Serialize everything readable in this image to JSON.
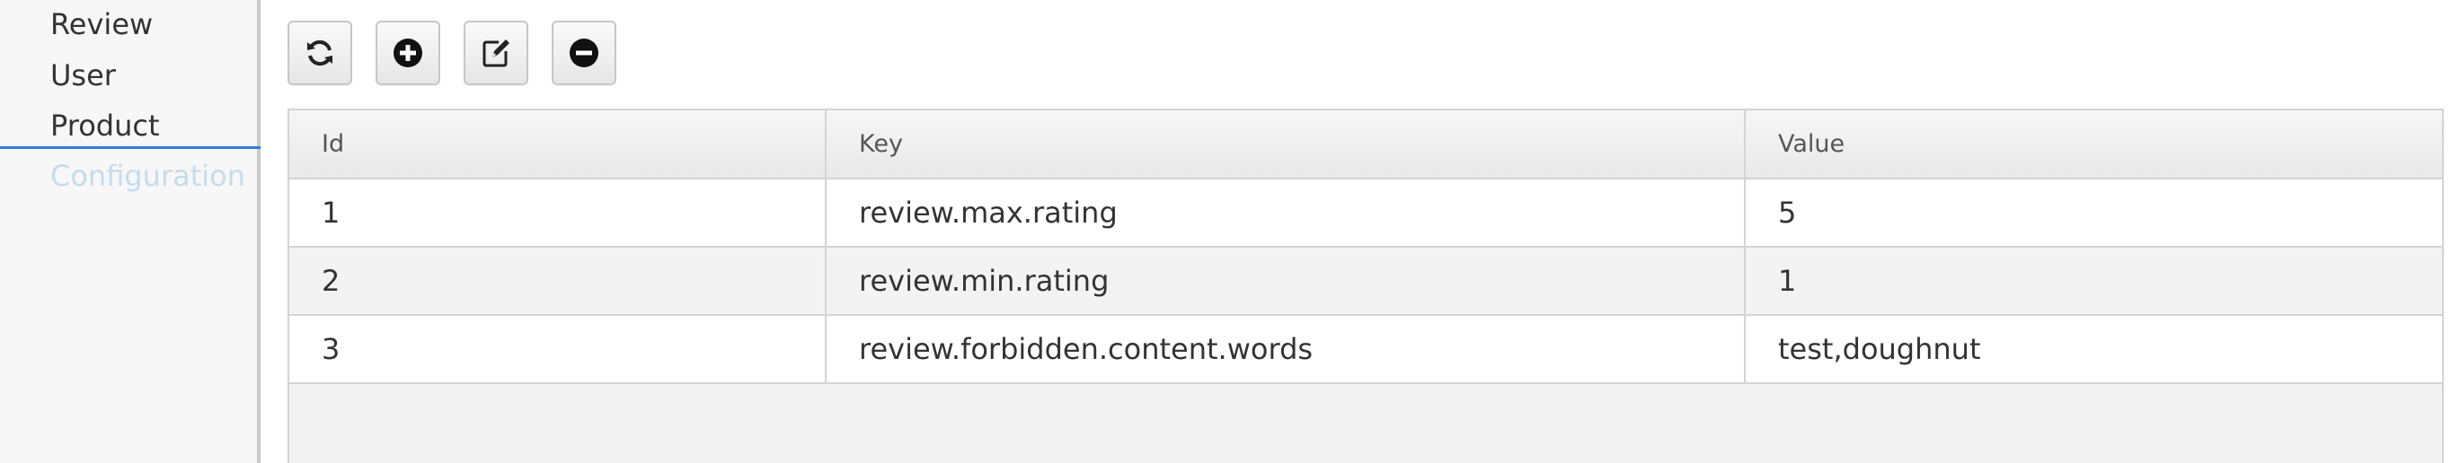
{
  "sidebar": {
    "items": [
      {
        "label": "Review"
      },
      {
        "label": "User"
      },
      {
        "label": "Product"
      },
      {
        "label": "Configuration",
        "active": true
      }
    ]
  },
  "toolbar": {
    "buttons": [
      {
        "icon": "refresh-icon"
      },
      {
        "icon": "plus-circle-icon"
      },
      {
        "icon": "edit-icon"
      },
      {
        "icon": "minus-circle-icon"
      }
    ]
  },
  "table": {
    "columns": [
      "Id",
      "Key",
      "Value"
    ],
    "rows": [
      {
        "id": "1",
        "key": "review.max.rating",
        "value": "5"
      },
      {
        "id": "2",
        "key": "review.min.rating",
        "value": "1"
      },
      {
        "id": "3",
        "key": "review.forbidden.content.words",
        "value": "test,doughnut"
      }
    ]
  },
  "colors": {
    "accent": "#2f7ed8",
    "active_nav_text": "#c6dced"
  }
}
